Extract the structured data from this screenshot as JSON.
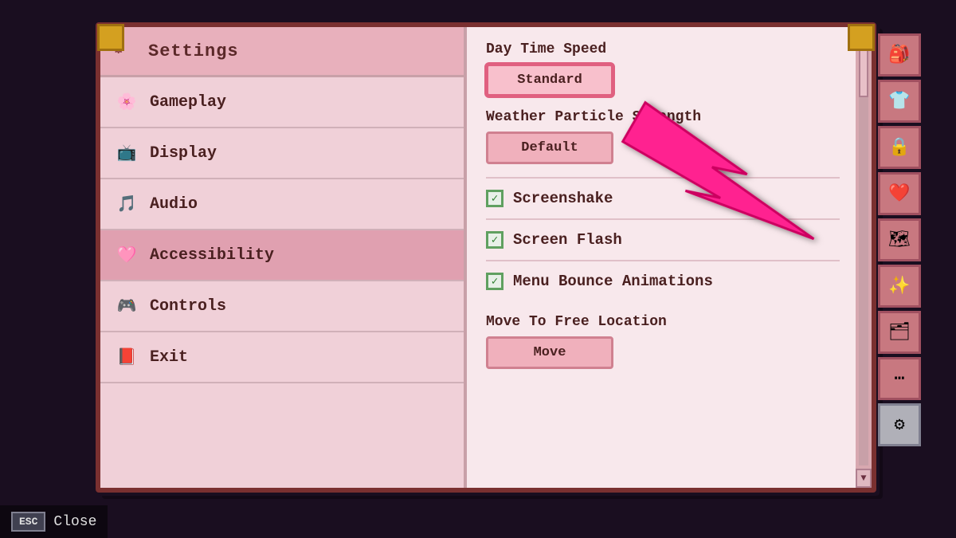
{
  "background": {
    "color": "#1a0e20"
  },
  "header": {
    "settings_label": "Settings"
  },
  "menu": {
    "items": [
      {
        "id": "gameplay",
        "label": "Gameplay",
        "icon": "🌸"
      },
      {
        "id": "display",
        "label": "Display",
        "icon": "📺"
      },
      {
        "id": "audio",
        "label": "Audio",
        "icon": "🎵"
      },
      {
        "id": "accessibility",
        "label": "Accessibility",
        "icon": "🩷",
        "active": true
      },
      {
        "id": "controls",
        "label": "Controls",
        "icon": "🎮"
      },
      {
        "id": "exit",
        "label": "Exit",
        "icon": "📕"
      }
    ]
  },
  "right_panel": {
    "sections": [
      {
        "id": "daytime-speed",
        "label": "Day Time Speed",
        "type": "button",
        "value": "Standard",
        "highlighted": true
      },
      {
        "id": "weather-particles",
        "label": "Weather Particle Strength",
        "type": "button",
        "value": "Default",
        "highlighted": false
      },
      {
        "id": "screenshake",
        "label": "Screenshake",
        "type": "checkbox",
        "checked": true
      },
      {
        "id": "screen-flash",
        "label": "Screen Flash",
        "type": "checkbox",
        "checked": true
      },
      {
        "id": "menu-bounce",
        "label": "Menu Bounce Animations",
        "type": "checkbox",
        "checked": true
      },
      {
        "id": "move-location",
        "label": "Move To Free Location",
        "type": "button",
        "value": "Move",
        "highlighted": false
      }
    ]
  },
  "right_sidebar": {
    "icons": [
      {
        "id": "bag",
        "icon": "🎒"
      },
      {
        "id": "shirt",
        "icon": "👕"
      },
      {
        "id": "lock",
        "icon": "🔒"
      },
      {
        "id": "heart",
        "icon": "❤️"
      },
      {
        "id": "map",
        "icon": "🗺"
      },
      {
        "id": "sparkle",
        "icon": "✨"
      },
      {
        "id": "grid",
        "icon": "🗂"
      },
      {
        "id": "dots",
        "icon": "⋯"
      }
    ]
  },
  "footer": {
    "esc_label": "ESC",
    "close_label": "Close"
  }
}
